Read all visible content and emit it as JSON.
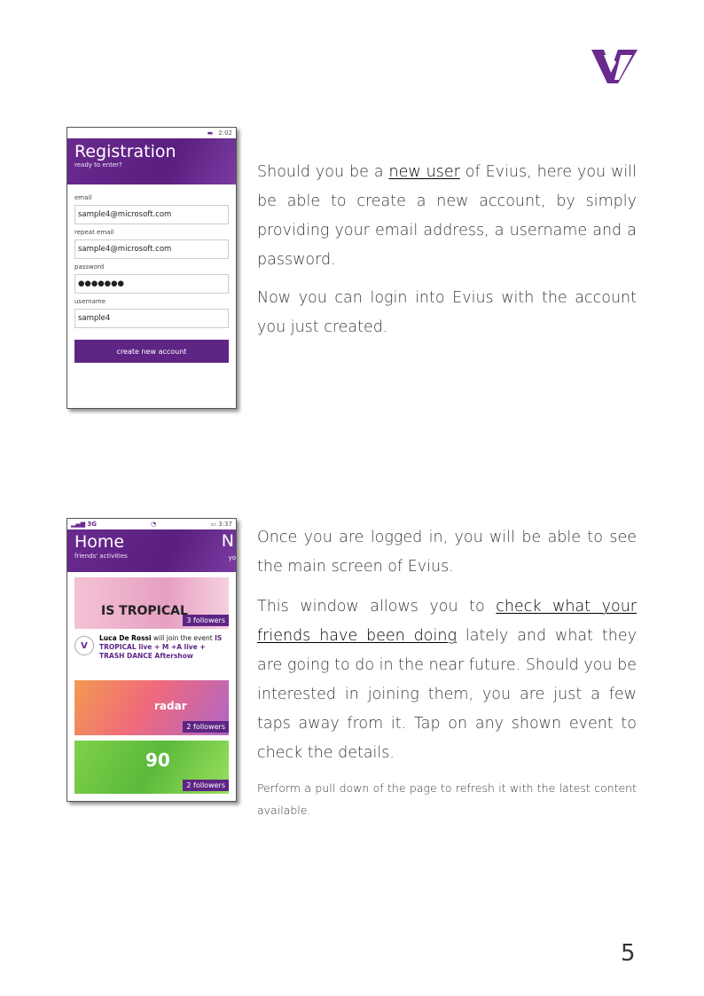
{
  "brand": {
    "logo": "evius-logo",
    "color": "#6a2a8e"
  },
  "registration_screen": {
    "time": "2:02",
    "title": "Registration",
    "subtitle": "ready to enter?",
    "fields": [
      {
        "label": "email",
        "value": "sample4@microsoft.com"
      },
      {
        "label": "repeat email",
        "value": "sample4@microsoft.com"
      },
      {
        "label": "password",
        "value": "●●●●●●●"
      },
      {
        "label": "username",
        "value": "sample4"
      }
    ],
    "button": "create new account"
  },
  "home_screen": {
    "network": "3G",
    "time": "3:37",
    "title": "Home",
    "subtitle": "friends' activities",
    "peek_title": "N",
    "peek_subtitle": "yo",
    "cards": [
      {
        "text": "IS TROPICAL",
        "followers": "3 followers"
      },
      {
        "text": "radar",
        "followers": "2 followers"
      },
      {
        "text": "90",
        "followers": "2 followers"
      }
    ],
    "notification": {
      "name": "Luca De Rossi",
      "action": " will join the event ",
      "event": "IS TROPICAL live + M +A live + TRASH DANCE Aftershow"
    }
  },
  "text": {
    "p1_pre": "Should you be a ",
    "p1_hl": "new user",
    "p1_post": " of Evius, here you will be able to create a new account, by simply providing your email address, a username and a password.",
    "p2": "Now you can login into Evius with the account you just created.",
    "p3": "Once you are logged in, you will be able to see the main screen of Evius.",
    "p4_pre": "This window allows you to ",
    "p4_hl": "check what your friends have been doing",
    "p4_post": " lately and what they are going to do in the near future. Should you be interested in joining them, you are just a few taps away from it. Tap on any shown event to check the details.",
    "p5": "Perform a pull down of the page to refresh it with the latest content available."
  },
  "page_number": "5"
}
